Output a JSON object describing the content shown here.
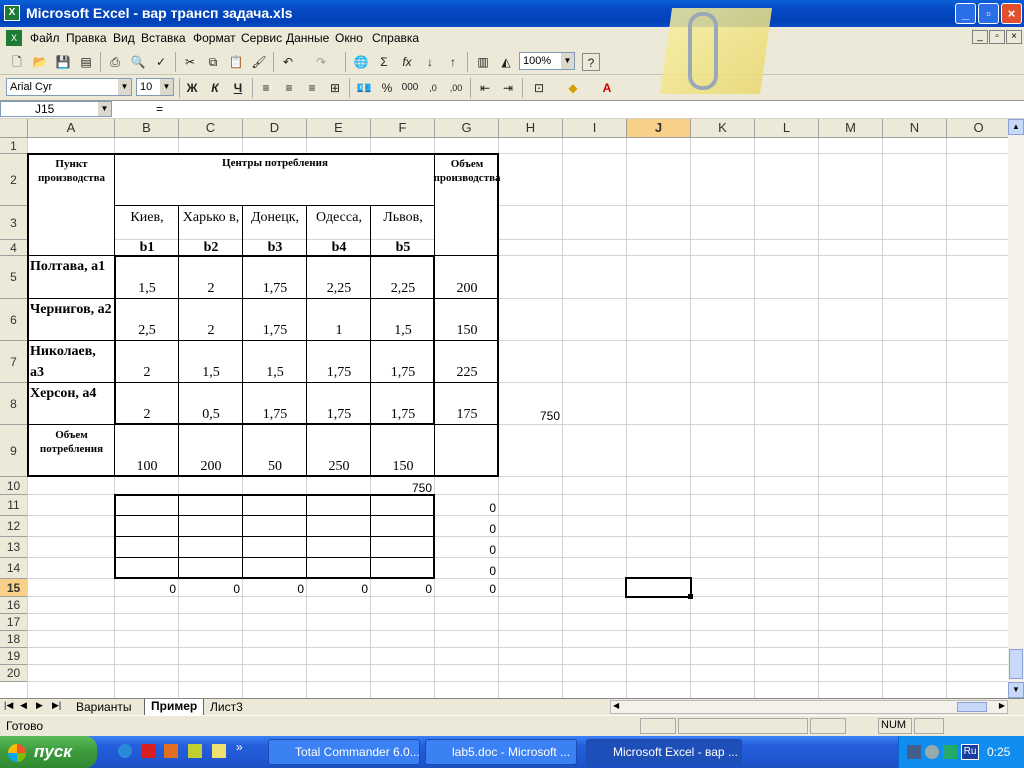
{
  "app": {
    "title": "Microsoft Excel - вар трансп задача.xls"
  },
  "menu": [
    "Файл",
    "Правка",
    "Вид",
    "Вставка",
    "Формат",
    "Сервис",
    "Данные",
    "Окно",
    "Справка"
  ],
  "toolbar": {
    "zoom": "100%",
    "font": "Arial Cyr",
    "size": "10",
    "bold": "Ж",
    "italic": "К",
    "underline": "Ч",
    "sigma": "Σ",
    "fx": "fx",
    "percent": "%",
    "thousands": "000"
  },
  "formula": {
    "namebox": "J15",
    "eq": "="
  },
  "columns": [
    "A",
    "B",
    "C",
    "D",
    "E",
    "F",
    "G",
    "H",
    "I",
    "J",
    "K",
    "L",
    "M",
    "N",
    "O"
  ],
  "rows": [
    "1",
    "2",
    "3",
    "4",
    "5",
    "6",
    "7",
    "8",
    "9",
    "10",
    "11",
    "12",
    "13",
    "14",
    "15",
    "16",
    "17",
    "18",
    "19",
    "20"
  ],
  "sheet": {
    "punkt": "Пункт производства",
    "centers": "Центры потребления",
    "volume_prod": "Объем производства",
    "volume_cons": "Объем потребления",
    "cities": [
      "Киев,",
      "Харько в,",
      "Донецк,",
      "Одесса,",
      "Львов,"
    ],
    "bcodes": [
      "b1",
      "b2",
      "b3",
      "b4",
      "b5"
    ],
    "sources": [
      "Полтава, а1",
      "Чернигов, а2",
      "Николаев, а3",
      "Херсон, а4"
    ],
    "costs": [
      [
        "1,5",
        "2",
        "1,75",
        "2,25",
        "2,25"
      ],
      [
        "2,5",
        "2",
        "1,75",
        "1",
        "1,5"
      ],
      [
        "2",
        "1,5",
        "1,5",
        "1,75",
        "1,75"
      ],
      [
        "2",
        "0,5",
        "1,75",
        "1,75",
        "1,75"
      ]
    ],
    "production": [
      "200",
      "150",
      "225",
      "175"
    ],
    "h8": "750",
    "consumption": [
      "100",
      "200",
      "50",
      "250",
      "150"
    ],
    "f10": "750",
    "g_zero": [
      "0",
      "0",
      "0",
      "0"
    ],
    "row15": [
      "0",
      "0",
      "0",
      "0",
      "0",
      "0"
    ]
  },
  "tabs": [
    "Варианты",
    "Пример",
    "Лист3"
  ],
  "status": {
    "ready": "Готово",
    "num": "NUM"
  },
  "taskbar": {
    "start": "пуск",
    "tasks": [
      "Total Commander 6.0...",
      "lab5.doc - Microsoft ...",
      "Microsoft Excel - вар ..."
    ],
    "lang": "Ru",
    "clock": "0:25"
  }
}
